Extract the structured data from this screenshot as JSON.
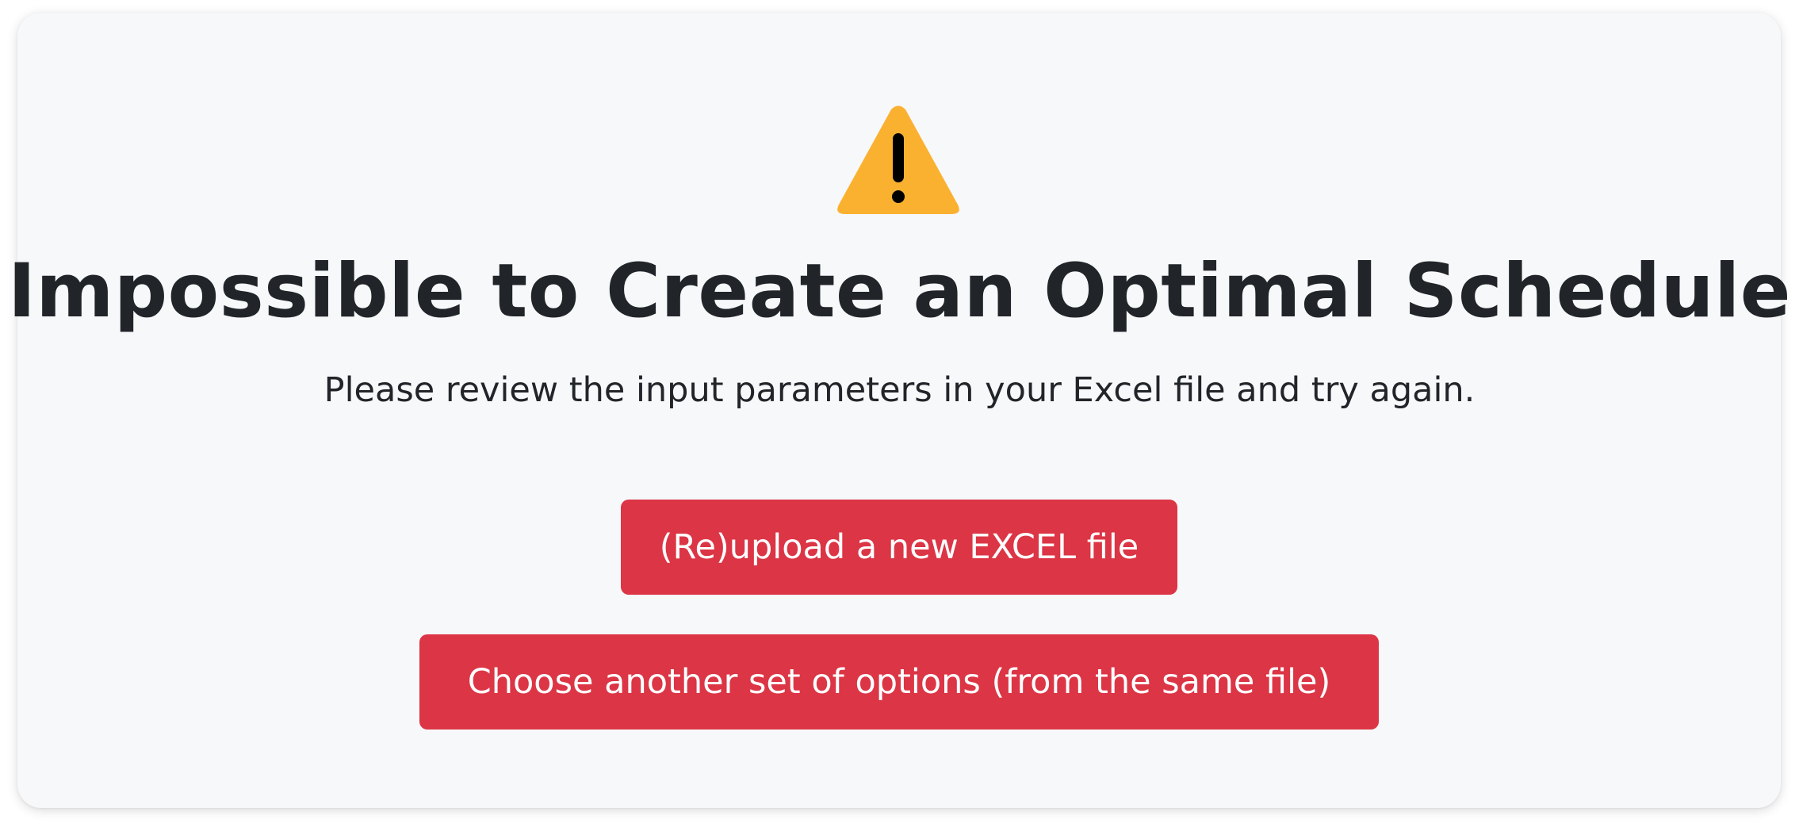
{
  "icon": {
    "name": "warning-triangle-icon",
    "fill_color": "#fbb130",
    "mark_color": "#000000"
  },
  "title": "Impossible to Create an Optimal Schedule",
  "subtitle": "Please review the input parameters in your Excel file and try again.",
  "buttons": {
    "reupload_label": "(Re)upload a new EXCEL file",
    "options_label": "Choose another set of options (from the same file)",
    "color": "#dc3545"
  }
}
